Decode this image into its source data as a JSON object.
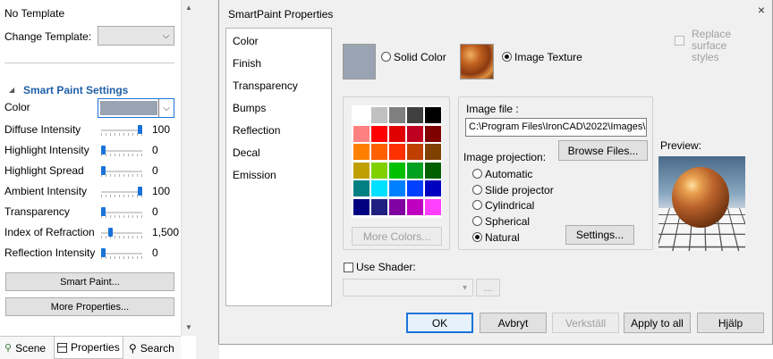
{
  "left_panel": {
    "template_text": "No Template",
    "change_template_label": "Change Template:",
    "section_title": "Smart Paint Settings",
    "color_label": "Color",
    "color_value": "#9aa3b1",
    "rows": [
      {
        "label": "Diffuse Intensity",
        "value": "100",
        "fraction": 1.0
      },
      {
        "label": "Highlight Intensity",
        "value": "0",
        "fraction": 0.0
      },
      {
        "label": "Highlight Spread",
        "value": "0",
        "fraction": 0.0
      },
      {
        "label": "Ambient Intensity",
        "value": "100",
        "fraction": 1.0
      },
      {
        "label": "Transparency",
        "value": "0",
        "fraction": 0.0
      },
      {
        "label": "Index of Refraction",
        "value": "1,500",
        "fraction": 0.2
      },
      {
        "label": "Reflection Intensity",
        "value": "0",
        "fraction": 0.0
      }
    ],
    "smart_paint_button": "Smart Paint...",
    "more_properties_button": "More Properties...",
    "tabs": [
      "Scene",
      "Properties",
      "Search"
    ],
    "active_tab": "Properties"
  },
  "dialog": {
    "title": "SmartPaint Properties",
    "close_glyph": "×",
    "nav_items": [
      "Color",
      "Finish",
      "Transparency",
      "Bumps",
      "Reflection",
      "Decal",
      "Emission"
    ],
    "solid_color_label": "Solid Color",
    "image_texture_label": "Image Texture",
    "selected_mode": "Image Texture",
    "replace_surface_styles": "Replace surface styles",
    "palette": [
      "#ffffff",
      "#c0c0c0",
      "#808080",
      "#404040",
      "#000000",
      "#ff8080",
      "#ff0000",
      "#e00000",
      "#c00020",
      "#800000",
      "#ff8000",
      "#ff6000",
      "#ff3000",
      "#c04000",
      "#804000",
      "#c0a000",
      "#80d000",
      "#00c000",
      "#00a020",
      "#006000",
      "#008080",
      "#00e0ff",
      "#0080ff",
      "#0040ff",
      "#0000c0",
      "#000080",
      "#202080",
      "#8000a0",
      "#c000c0",
      "#ff40ff"
    ],
    "more_colors_button": "More Colors...",
    "image_file_label": "Image file :",
    "image_file_path": "C:\\Program Files\\IronCAD\\2022\\Images\\",
    "browse_files_button": "Browse Files...",
    "image_projection_label": "Image projection:",
    "projections": [
      "Automatic",
      "Slide projector",
      "Cylindrical",
      "Spherical",
      "Natural"
    ],
    "selected_projection": "Natural",
    "settings_button": "Settings...",
    "preview_label": "Preview:",
    "use_shader_label": "Use Shader:",
    "shader_browse": "...",
    "buttons": {
      "ok": "OK",
      "apply": "Avbryt",
      "cancel": "Verkställ",
      "apply_all": "Apply to all",
      "help": "Hjälp"
    }
  }
}
